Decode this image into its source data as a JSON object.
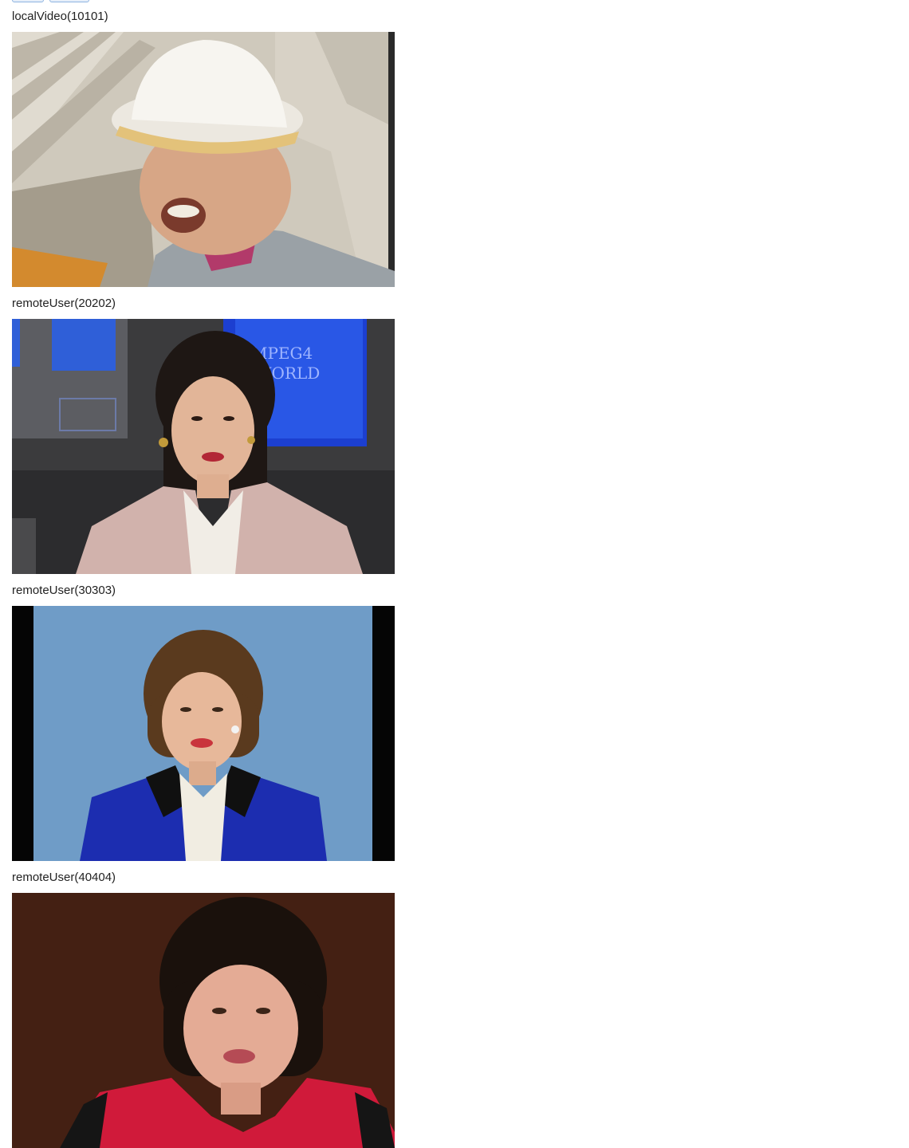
{
  "toolbar": {
    "buttons": [
      {
        "label": ""
      },
      {
        "label": ""
      }
    ]
  },
  "feeds": [
    {
      "label": "localVideo(10101)",
      "kind": "local"
    },
    {
      "label": "remoteUser(20202)",
      "kind": "remote"
    },
    {
      "label": "remoteUser(30303)",
      "kind": "remote"
    },
    {
      "label": "remoteUser(40404)",
      "kind": "remote"
    }
  ]
}
